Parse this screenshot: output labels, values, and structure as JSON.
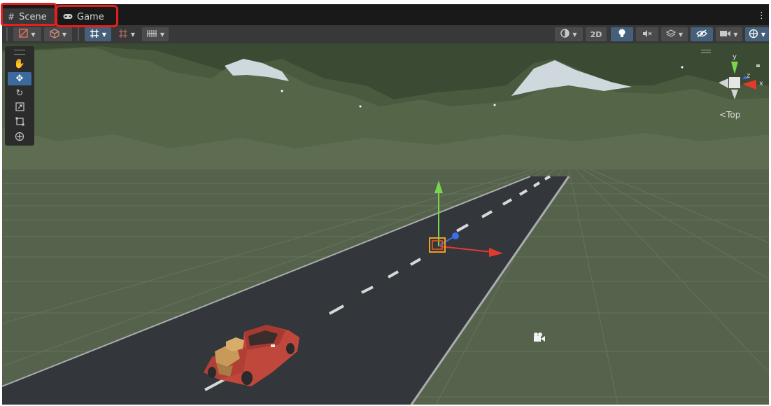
{
  "tabs": [
    {
      "label": "Scene",
      "icon": "grid-icon",
      "active": true
    },
    {
      "label": "Game",
      "icon": "gamepad-icon",
      "active": false
    }
  ],
  "toolbar": {
    "two_d_label": "2D"
  },
  "transform_tools": [
    "hand-tool",
    "move-tool",
    "rotate-tool",
    "scale-tool",
    "rect-tool",
    "transform-tool"
  ],
  "active_tool": "move-tool",
  "gizmo": {
    "view_label": "Top",
    "axis_x": "x",
    "axis_y": "y",
    "axis_z": "z"
  },
  "colors": {
    "annotation": "#e51e1e",
    "active_button": "#3d6a9c",
    "sky": "#3a4a33",
    "ground": "#56634c",
    "road": "#33363b",
    "truck": "#c0473c"
  }
}
